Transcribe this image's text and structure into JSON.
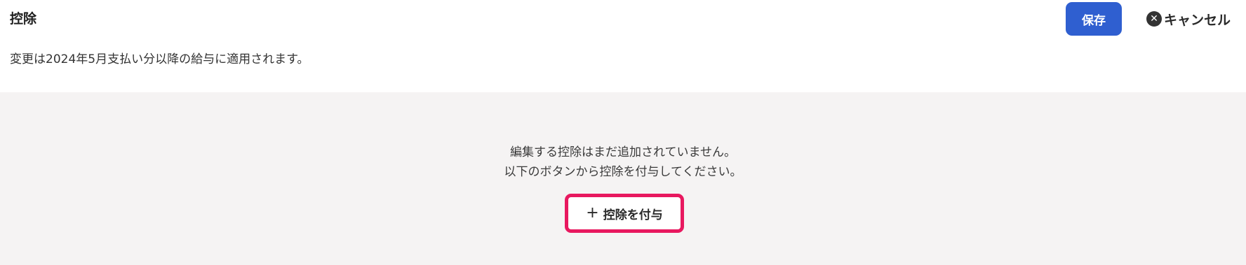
{
  "header": {
    "title": "控除",
    "notice": "変更は2024年5月支払い分以降の給与に適用されます。",
    "save_label": "保存",
    "cancel_label": "キャンセル",
    "cancel_icon_glyph": "✕"
  },
  "empty_state": {
    "line1": "編集する控除はまだ追加されていません。",
    "line2": "以下のボタンから控除を付与してください。",
    "add_icon_glyph": "+",
    "add_label": "控除を付与"
  },
  "colors": {
    "primary": "#2f5fd0",
    "highlight_border": "#e8185f",
    "panel_bg": "#f5f3f3"
  }
}
